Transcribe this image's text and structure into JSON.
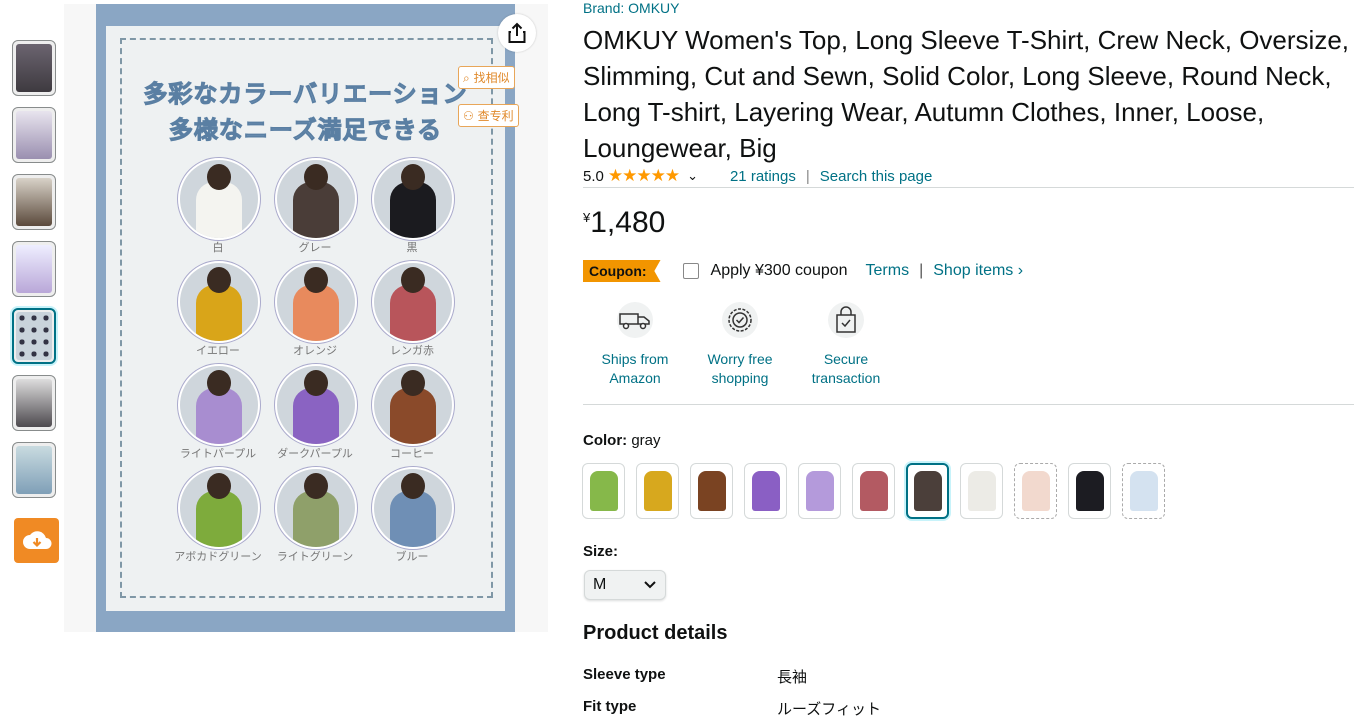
{
  "thumbnails": [
    "thumb-1",
    "thumb-2",
    "thumb-3",
    "thumb-4",
    "thumb-5",
    "thumb-6",
    "thumb-7"
  ],
  "poster": {
    "title_line1": "多彩なカラーバリエーション",
    "title_line2": "多様なニーズ満足できる",
    "tag1": "找相似",
    "tag2": "查专利",
    "colors": [
      {
        "label": "白",
        "shirt": "#f4f4f0"
      },
      {
        "label": "グレー",
        "shirt": "#4a3d38"
      },
      {
        "label": "黒",
        "shirt": "#1b1b1f"
      },
      {
        "label": "イエロー",
        "shirt": "#d9a519"
      },
      {
        "label": "オレンジ",
        "shirt": "#e88a5d"
      },
      {
        "label": "レンガ赤",
        "shirt": "#b8555b"
      },
      {
        "label": "ライトパープル",
        "shirt": "#a88dd0"
      },
      {
        "label": "ダークパープル",
        "shirt": "#8a63c2"
      },
      {
        "label": "コーヒー",
        "shirt": "#8a4a2a"
      },
      {
        "label": "アボカドグリーン",
        "shirt": "#7eab3c"
      },
      {
        "label": "ライトグリーン",
        "shirt": "#8fa06a"
      },
      {
        "label": "ブルー",
        "shirt": "#6f8fb5"
      }
    ]
  },
  "product": {
    "brand": "Brand: OMKUY",
    "title": "OMKUY Women's Top, Long Sleeve T-Shirt, Crew Neck, Oversize, Slimming, Cut and Sewn, Solid Color, Long Sleeve, Round Neck, Long T-shirt, Layering Wear, Autumn Clothes, Inner, Loose, Loungewear, Big",
    "rating_value": "5.0",
    "stars": "★★★★★",
    "ratings_count": "21 ratings",
    "search_page": "Search this page",
    "price_symbol": "¥",
    "price": "1,480",
    "coupon_badge": "Coupon:",
    "coupon_text": "Apply ¥300 coupon",
    "terms": "Terms",
    "shop_items": "Shop items ›",
    "features": [
      {
        "l1": "Ships from",
        "l2": "Amazon",
        "icon": "truck-icon"
      },
      {
        "l1": "Worry free",
        "l2": "shopping",
        "icon": "badge-check-icon"
      },
      {
        "l1": "Secure",
        "l2": "transaction",
        "icon": "secure-bag-icon"
      }
    ],
    "color_label": "Color:",
    "color_value": "gray",
    "swatches": [
      {
        "color": "#86b84a",
        "state": "available"
      },
      {
        "color": "#d7a81e",
        "state": "available"
      },
      {
        "color": "#7a4322",
        "state": "available"
      },
      {
        "color": "#8a5fc4",
        "state": "available"
      },
      {
        "color": "#b49adb",
        "state": "available"
      },
      {
        "color": "#b35a62",
        "state": "available"
      },
      {
        "color": "#4b3f3a",
        "state": "selected"
      },
      {
        "color": "#ecebe6",
        "state": "available"
      },
      {
        "color": "#e9c0ae",
        "state": "unavailable"
      },
      {
        "color": "#1c1c22",
        "state": "available"
      },
      {
        "color": "#b7cfe6",
        "state": "unavailable"
      }
    ],
    "size_label": "Size:",
    "size_value": "M",
    "details_title": "Product details",
    "details": [
      {
        "key": "Sleeve type",
        "value": "長袖"
      },
      {
        "key": "Fit type",
        "value": "ルーズフィット"
      }
    ]
  },
  "colors": {
    "link": "#007185",
    "accent": "#f29500",
    "star": "#ff9900"
  }
}
